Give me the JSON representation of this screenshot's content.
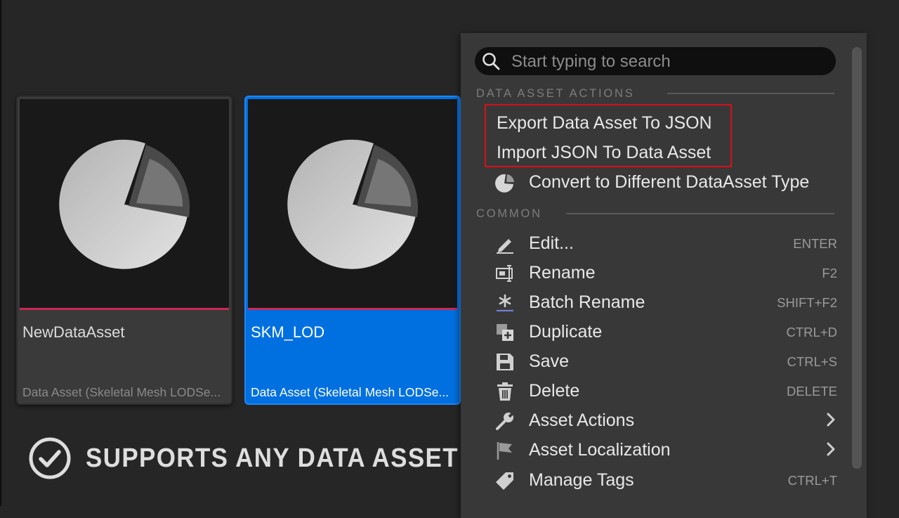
{
  "assets": [
    {
      "name": "NewDataAsset",
      "type": "Data Asset (Skeletal Mesh LODSe..."
    },
    {
      "name": "SKM_LOD",
      "type": "Data Asset (Skeletal Mesh LODSe..."
    }
  ],
  "banner": {
    "text": "SUPPORTS ANY DATA ASSET",
    "icon": "check-circle-icon"
  },
  "menu": {
    "search": {
      "placeholder": "Start typing to search",
      "value": ""
    },
    "sections": {
      "data_asset_actions": "DATA ASSET ACTIONS",
      "common": "COMMON"
    },
    "data_asset_items": [
      {
        "label": "Export Data Asset To JSON"
      },
      {
        "label": "Import JSON To Data Asset"
      },
      {
        "label": "Convert to Different DataAsset Type",
        "icon": "pie-chart-icon"
      }
    ],
    "common_items": [
      {
        "label": "Edit...",
        "shortcut": "ENTER",
        "icon": "pencil-icon"
      },
      {
        "label": "Rename",
        "shortcut": "F2",
        "icon": "rename-icon"
      },
      {
        "label": "Batch Rename",
        "shortcut": "SHIFT+F2",
        "icon": "asterisk-icon"
      },
      {
        "label": "Duplicate",
        "shortcut": "CTRL+D",
        "icon": "duplicate-icon"
      },
      {
        "label": "Save",
        "shortcut": "CTRL+S",
        "icon": "floppy-icon"
      },
      {
        "label": "Delete",
        "shortcut": "DELETE",
        "icon": "trash-icon"
      },
      {
        "label": "Asset Actions",
        "shortcut": "",
        "icon": "wrench-icon",
        "submenu": true
      },
      {
        "label": "Asset Localization",
        "shortcut": "",
        "icon": "flag-icon",
        "submenu": true
      },
      {
        "label": "Manage Tags",
        "shortcut": "CTRL+T",
        "icon": "tag-icon"
      }
    ]
  },
  "colors": {
    "background": "#262626",
    "selection": "#0070e0",
    "asset_bar": "#cc2855",
    "highlight_box": "#d80f1a",
    "menu_bg": "#383838"
  }
}
